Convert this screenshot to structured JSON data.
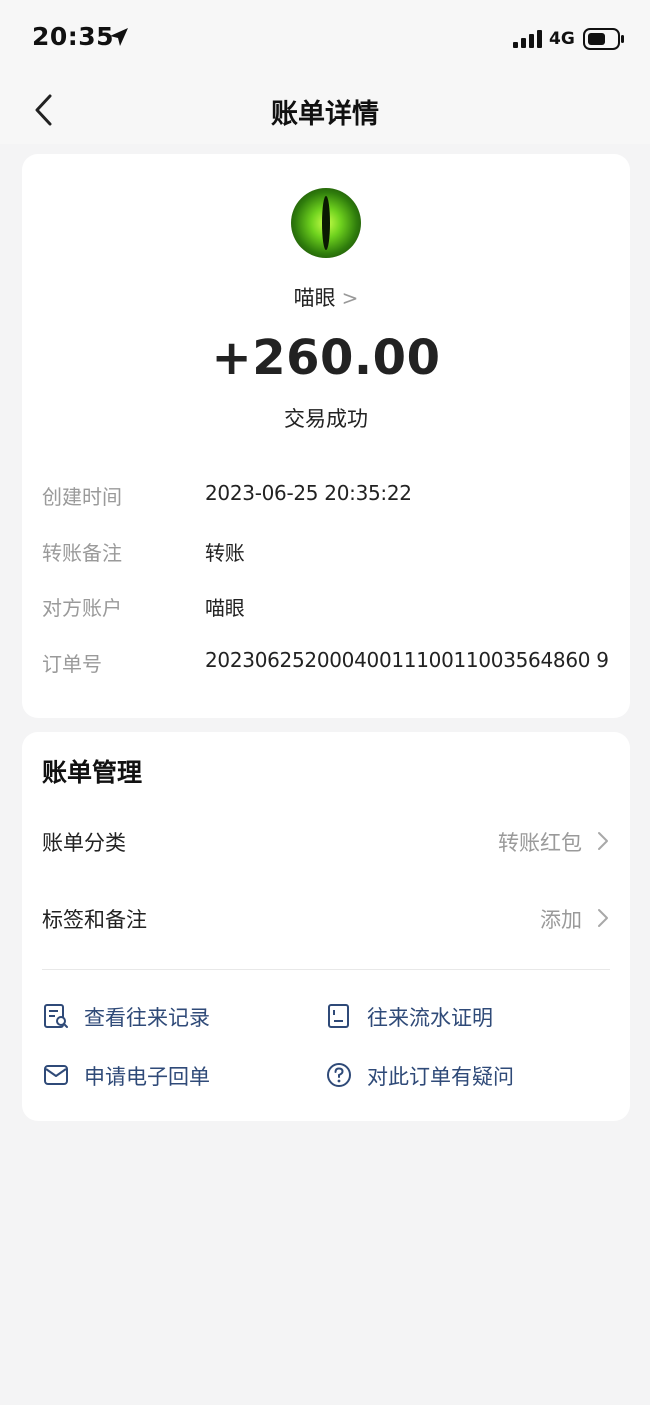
{
  "status_bar": {
    "time": "20:35",
    "network": "4G"
  },
  "nav": {
    "title": "账单详情"
  },
  "transaction": {
    "payee": "喵眼",
    "amount": "+260.00",
    "status": "交易成功",
    "details": [
      {
        "label": "创建时间",
        "value": "2023-06-25 20:35:22"
      },
      {
        "label": "转账备注",
        "value": "转账"
      },
      {
        "label": "对方账户",
        "value": "喵眼"
      },
      {
        "label": "订单号",
        "value": "2023062520004001110011003564860 9"
      }
    ]
  },
  "manage": {
    "title": "账单管理",
    "rows": [
      {
        "label": "账单分类",
        "value": "转账红包"
      },
      {
        "label": "标签和备注",
        "value": "添加"
      }
    ],
    "actions": [
      {
        "label": "查看往来记录",
        "icon": "record-search-icon"
      },
      {
        "label": "往来流水证明",
        "icon": "statement-icon"
      },
      {
        "label": "申请电子回单",
        "icon": "envelope-icon"
      },
      {
        "label": "对此订单有疑问",
        "icon": "question-icon"
      }
    ]
  },
  "colors": {
    "background": "#f4f4f5",
    "card": "#ffffff",
    "link": "#2f4a78",
    "muted": "#9a9a9a"
  }
}
